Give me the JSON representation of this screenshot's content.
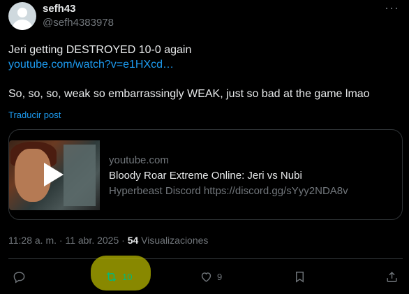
{
  "author": {
    "name": "sefh43",
    "handle": "@sefh4383978",
    "more_icon": "more-horizontal-icon"
  },
  "post": {
    "line1": "Jeri getting DESTROYED 10-0 again",
    "link": "youtube.com/watch?v=e1HXcd…",
    "line3": "So, so, so, weak so embarrassingly WEAK, just so bad at the game lmao",
    "translate": "Traducir post"
  },
  "card": {
    "domain": "youtube.com",
    "title": "Bloody Roar Extreme Online: Jeri vs Nubi",
    "description": "Hyperbeast Discord https://discord.gg/sYyy2NDA8v"
  },
  "meta": {
    "timestamp": "11:28 a. m. · 11 abr. 2025 · ",
    "views_count": "54",
    "views_label": " Visualizaciones"
  },
  "actions": {
    "reply_count": "",
    "retweet_count": "10",
    "like_count": "9"
  },
  "colors": {
    "background": "#000000",
    "link": "#1d9bf0",
    "muted": "#71767b",
    "retweet": "#00ba7c",
    "highlight": "#b6b600"
  }
}
